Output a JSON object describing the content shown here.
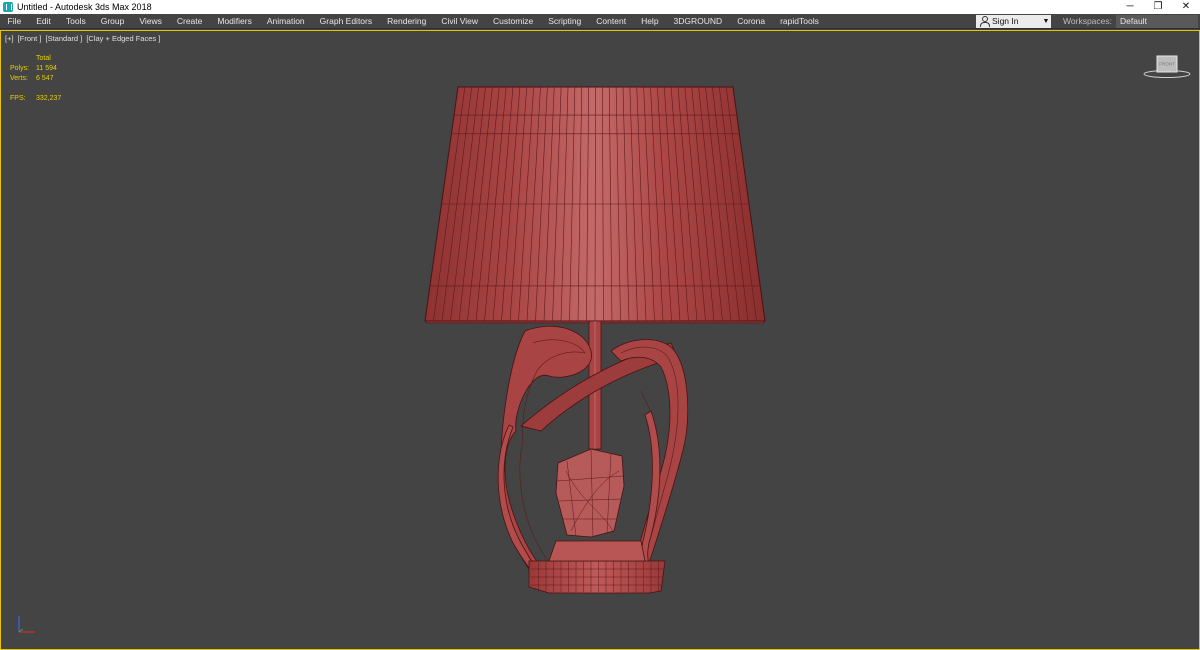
{
  "window": {
    "title": "Untitled - Autodesk 3ds Max 2018",
    "controls": {
      "minimize": "─",
      "restore": "❐",
      "close": "✕"
    }
  },
  "menu": {
    "items": [
      "File",
      "Edit",
      "Tools",
      "Group",
      "Views",
      "Create",
      "Modifiers",
      "Animation",
      "Graph Editors",
      "Rendering",
      "Civil View",
      "Customize",
      "Scripting",
      "Content",
      "Help",
      "3DGROUND",
      "Corona",
      "rapidTools"
    ],
    "signin": {
      "label": "Sign In",
      "caret": "▼"
    },
    "workspaces": {
      "label": "Workspaces:",
      "value": "Default"
    }
  },
  "viewport": {
    "label": [
      "[+]",
      "[Front ]",
      "[Standard ]",
      "[Clay + Edged Faces ]"
    ],
    "stats": {
      "header": "Total",
      "polys_label": "Polys:",
      "polys_value": "11 594",
      "verts_label": "Verts:",
      "verts_value": "6 547",
      "fps_label": "FPS:",
      "fps_value": "332,237"
    },
    "viewcube_label": "FRONT"
  },
  "colors": {
    "viewport_bg": "#444444",
    "active_border": "#e8c400",
    "stats_text": "#e8d000",
    "clay_red": "#b04848",
    "wire": "#5a1616"
  }
}
